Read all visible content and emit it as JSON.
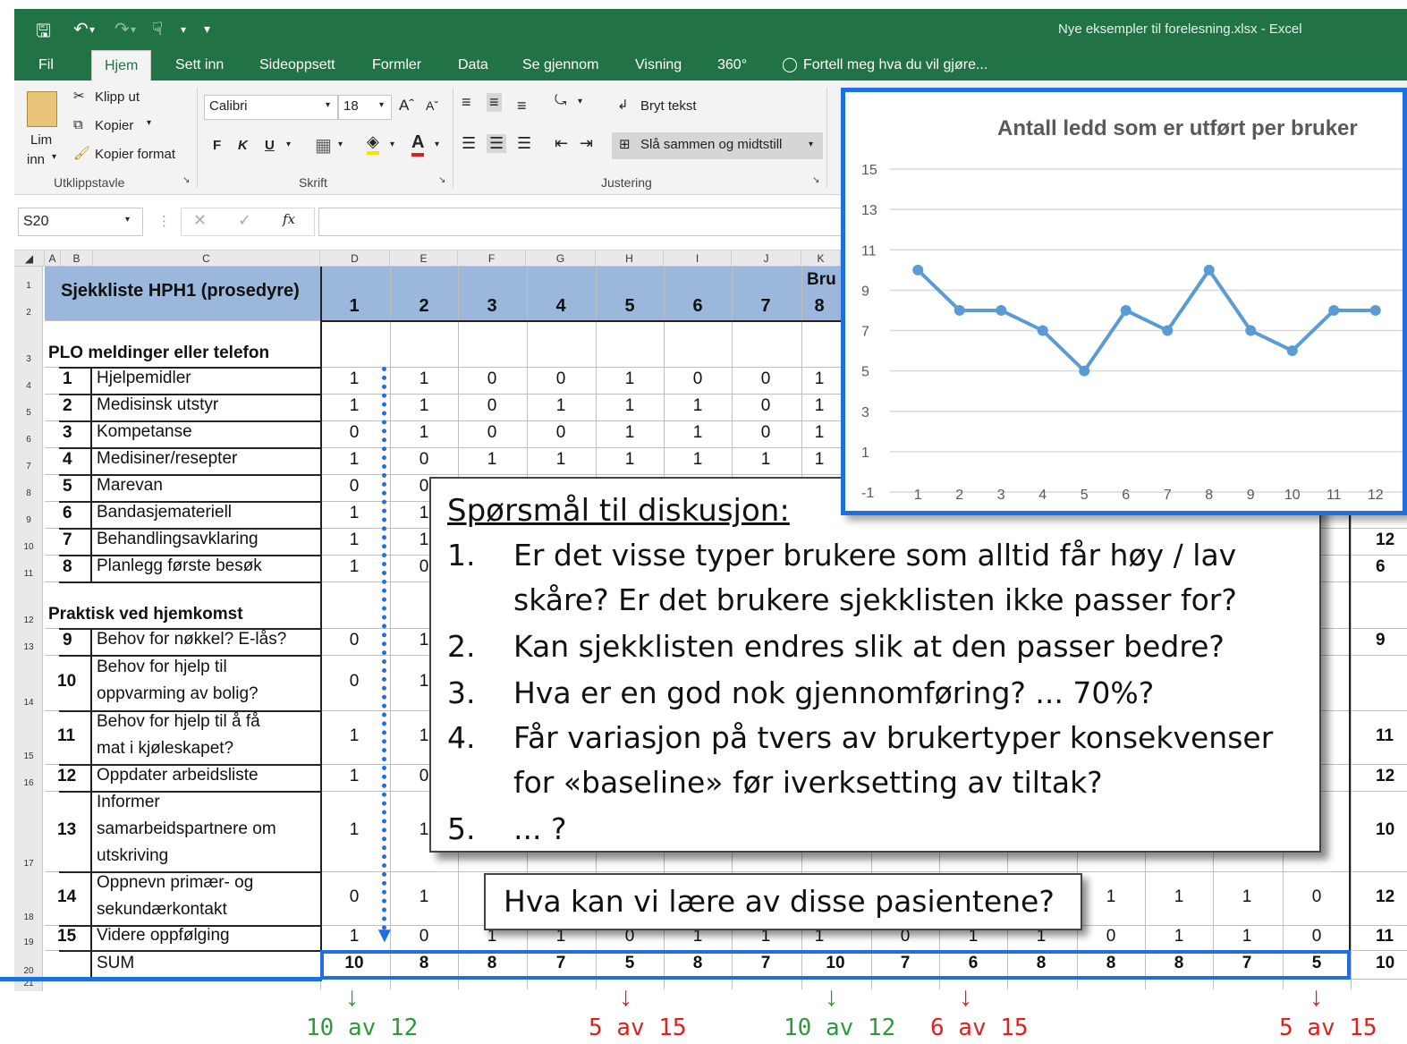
{
  "window": {
    "title": "Nye eksempler til forelesning.xlsx - Excel"
  },
  "menu": {
    "tabs": [
      "Fil",
      "Hjem",
      "Sett inn",
      "Sideoppsett",
      "Formler",
      "Data",
      "Se gjennom",
      "Visning",
      "360°"
    ],
    "tell_me": "Fortell meg hva du vil gjøre..."
  },
  "ribbon": {
    "paste": "Lim",
    "paste2": "inn",
    "cut": "Klipp ut",
    "copy": "Kopier",
    "format_painter": "Kopier format",
    "clipboard_group": "Utklippstavle",
    "font_name": "Calibri",
    "font_size": "18",
    "bold": "F",
    "italic": "K",
    "underline": "U",
    "font_group": "Skrift",
    "wrap_text": "Bryt tekst",
    "merge_center": "Slå sammen og midtstill",
    "alignment_group": "Justering"
  },
  "formula_bar": {
    "name_box": "S20",
    "fx": "fx",
    "value": ""
  },
  "sheet": {
    "title": "Sjekkliste HPH1 (prosedyre)",
    "users_header": "Bru",
    "columns": [
      "A",
      "B",
      "C",
      "D",
      "E",
      "F",
      "G",
      "H",
      "I",
      "J",
      "K"
    ],
    "user_ids": [
      "1",
      "2",
      "3",
      "4",
      "5",
      "6",
      "7",
      "8"
    ],
    "section1": "PLO meldinger eller telefon",
    "section2": "Praktisk ved hjemkomst",
    "items": [
      {
        "n": "1",
        "label": "Hjelpemidler",
        "vals": [
          "1",
          "1",
          "0",
          "0",
          "1",
          "0",
          "0",
          "1"
        ]
      },
      {
        "n": "2",
        "label": "Medisinsk utstyr",
        "vals": [
          "1",
          "1",
          "0",
          "1",
          "1",
          "1",
          "0",
          "1"
        ]
      },
      {
        "n": "3",
        "label": "Kompetanse",
        "vals": [
          "0",
          "1",
          "0",
          "0",
          "1",
          "1",
          "0",
          "1"
        ]
      },
      {
        "n": "4",
        "label": "Medisiner/resepter",
        "vals": [
          "1",
          "0",
          "1",
          "1",
          "1",
          "1",
          "1",
          "1"
        ]
      },
      {
        "n": "5",
        "label": "Marevan",
        "vals": [
          "0",
          "0"
        ]
      },
      {
        "n": "6",
        "label": "Bandasjemateriell",
        "vals": [
          "1",
          "1"
        ]
      },
      {
        "n": "7",
        "label": "Behandlingsavklaring",
        "vals": [
          "1",
          "1"
        ]
      },
      {
        "n": "8",
        "label": "Planlegg første besøk",
        "vals": [
          "1",
          "0"
        ]
      },
      {
        "n": "9",
        "label": "Behov for nøkkel? E-lås?",
        "vals": [
          "0",
          "1"
        ]
      },
      {
        "n": "10",
        "label": "Behov for hjelp til",
        "label2": "oppvarming av bolig?",
        "vals": [
          "0",
          "1"
        ]
      },
      {
        "n": "11",
        "label": "Behov for hjelp til å få",
        "label2": "mat i kjøleskapet?",
        "vals": [
          "1",
          "1"
        ]
      },
      {
        "n": "12",
        "label": "Oppdater arbeidsliste",
        "vals": [
          "1",
          "0"
        ]
      },
      {
        "n": "13",
        "label": "Informer",
        "label2": "samarbeidspartnere om",
        "label3": "utskriving",
        "vals": [
          "1",
          "1"
        ]
      },
      {
        "n": "14",
        "label": "Oppnevn primær- og",
        "label2": "sekundærkontakt",
        "vals": [
          "0",
          "1",
          "1",
          "1",
          "1",
          "0"
        ]
      },
      {
        "n": "15",
        "label": "Videre oppfølging",
        "vals": [
          "1",
          "0",
          "1",
          "1",
          "0",
          "1",
          "1",
          "1",
          "0",
          "1",
          "1",
          "0",
          "1",
          "1",
          "0"
        ]
      }
    ],
    "sum_label": "SUM",
    "sums": [
      "10",
      "8",
      "8",
      "7",
      "5",
      "8",
      "7",
      "10",
      "7",
      "6",
      "8",
      "8",
      "8",
      "7",
      "5"
    ],
    "right_totals": [
      "12",
      "6",
      "9",
      "11",
      "12",
      "10",
      "12",
      "11",
      "10"
    ],
    "row_numbers": [
      "1",
      "2",
      "3",
      "4",
      "5",
      "6",
      "7",
      "8",
      "9",
      "10",
      "11",
      "12",
      "13",
      "14",
      "15",
      "16",
      "17",
      "18",
      "19",
      "20",
      "21"
    ]
  },
  "questions": {
    "title": "Spørsmål til diskusjon:",
    "items": [
      {
        "n": "1.",
        "lines": [
          "Er det visse typer brukere som alltid får høy / lav",
          "skåre? Er det brukere sjekklisten ikke passer for?"
        ]
      },
      {
        "n": "2.",
        "lines": [
          "Kan sjekklisten endres slik at den passer bedre?"
        ]
      },
      {
        "n": "3.",
        "lines": [
          "Hva er en god nok gjennomføring? ... 70%?"
        ]
      },
      {
        "n": "4.",
        "lines": [
          "Får variasjon på tvers av brukertyper konsekvenser",
          "for «baseline» før iverksetting av tiltak?"
        ]
      },
      {
        "n": "5.",
        "lines": [
          "... ?"
        ]
      }
    ]
  },
  "patients_question": "Hva kan vi lære av disse pasientene?",
  "annotations": [
    {
      "text": "10 av 12",
      "color": "#2e9a3c"
    },
    {
      "text": "5 av 15",
      "color": "#e0201c"
    },
    {
      "text": "10 av 12",
      "color": "#2e9a3c"
    },
    {
      "text": "6 av 15",
      "color": "#e0201c"
    },
    {
      "text": "5 av 15",
      "color": "#e0201c"
    }
  ],
  "colors": {
    "excel_green": "#217346",
    "accent_blue": "#1f6fe0",
    "header_blue": "#9bb7db",
    "line_blue": "#5b9bd5",
    "good": "#2e9a3c",
    "bad": "#e0201c"
  },
  "chart_data": {
    "type": "line",
    "title": "Antall ledd som er utført per bruker",
    "x": [
      1,
      2,
      3,
      4,
      5,
      6,
      7,
      8,
      9,
      10,
      11,
      12
    ],
    "series": [
      {
        "values": [
          10,
          8,
          8,
          7,
          5,
          8,
          7,
          10,
          7,
          6,
          8,
          8
        ]
      }
    ],
    "yticks": [
      "15",
      "13",
      "11",
      "9",
      "7",
      "5",
      "3",
      "1",
      "-1"
    ],
    "ylim": [
      -1,
      15
    ],
    "grid": true
  }
}
